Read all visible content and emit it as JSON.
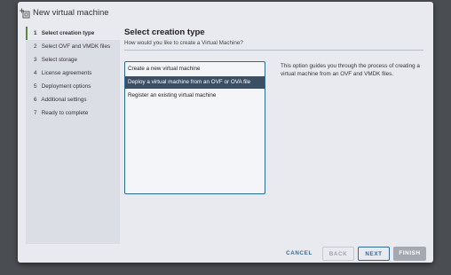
{
  "window": {
    "title": "New virtual machine",
    "icon": "new-vm-icon"
  },
  "steps": [
    {
      "num": "1",
      "label": "Select creation type",
      "active": true
    },
    {
      "num": "2",
      "label": "Select OVF and VMDK files",
      "active": false
    },
    {
      "num": "3",
      "label": "Select storage",
      "active": false
    },
    {
      "num": "4",
      "label": "License agreements",
      "active": false
    },
    {
      "num": "5",
      "label": "Deployment options",
      "active": false
    },
    {
      "num": "6",
      "label": "Additional settings",
      "active": false
    },
    {
      "num": "7",
      "label": "Ready to complete",
      "active": false
    }
  ],
  "main": {
    "heading": "Select creation type",
    "subheading": "How would you like to create a Virtual Machine?",
    "options": [
      {
        "label": "Create a new virtual machine",
        "selected": false
      },
      {
        "label": "Deploy a virtual machine from an OVF or OVA file",
        "selected": true
      },
      {
        "label": "Register an existing virtual machine",
        "selected": false
      }
    ],
    "description": "This option guides you through the process of creating a virtual machine from an OVF and VMDK files."
  },
  "buttons": {
    "cancel": "CANCEL",
    "back": "BACK",
    "next": "NEXT",
    "finish": "FINISH"
  },
  "colors": {
    "accent": "#2d6a9a",
    "selected_option": "#3c4e63",
    "active_step_marker": "#5a8a3a"
  }
}
